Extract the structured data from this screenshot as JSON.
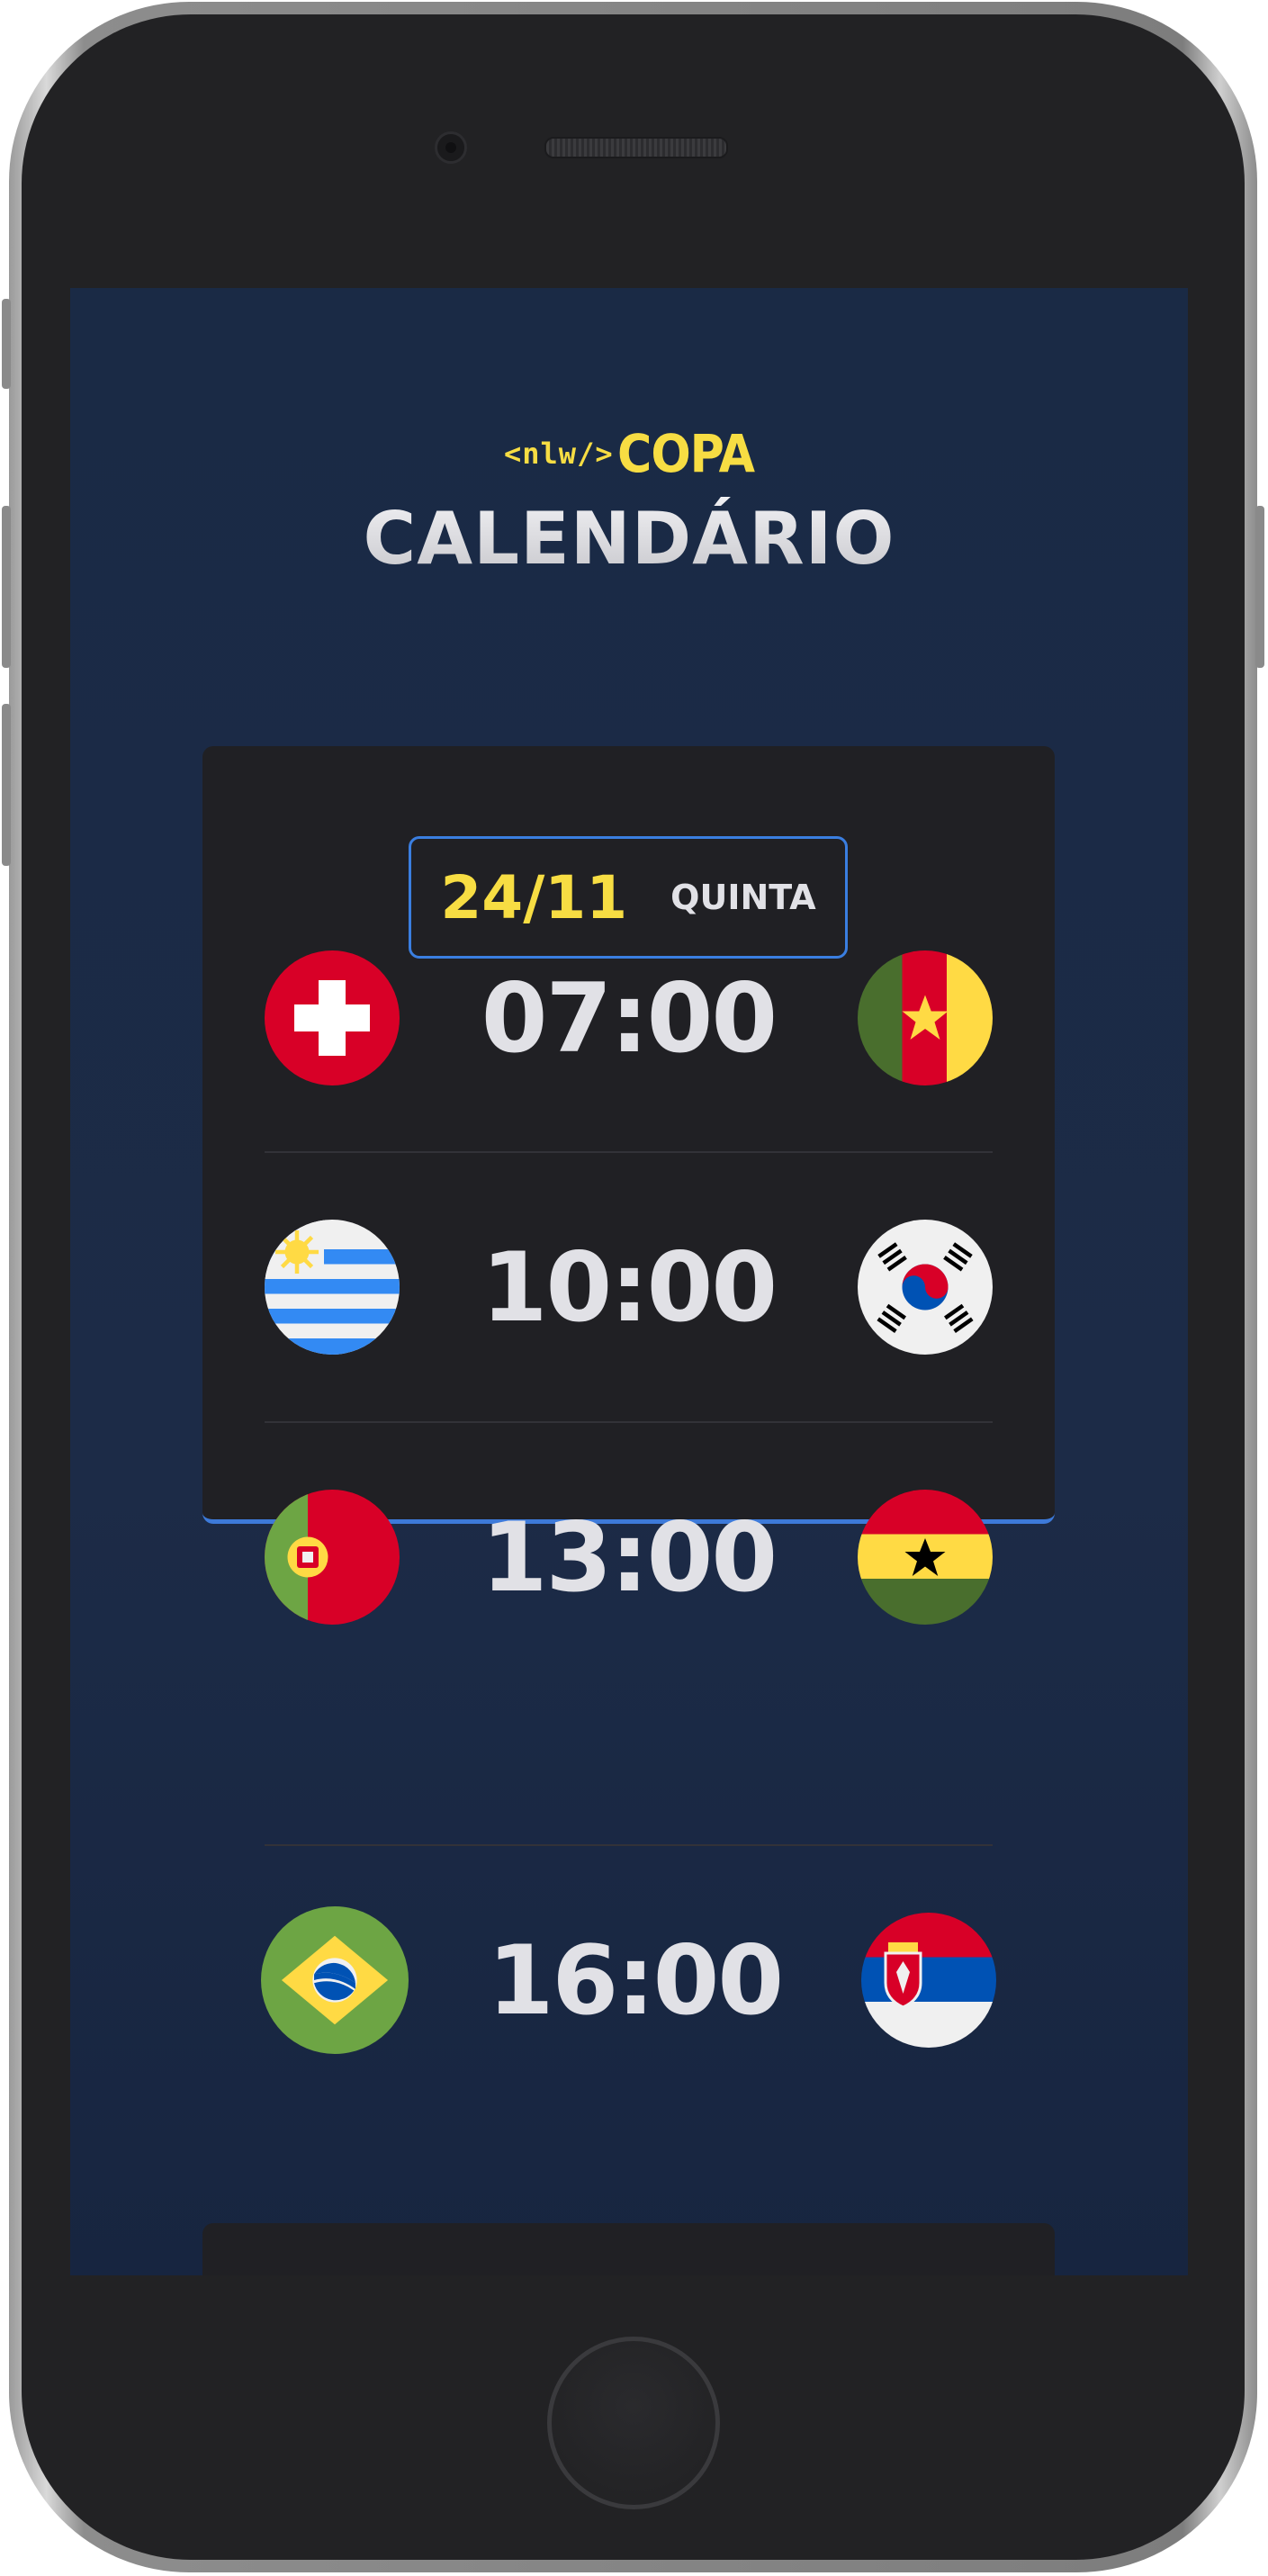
{
  "logo": {
    "tag": "<nlw/>",
    "name": "COPA"
  },
  "page": {
    "title": "CALENDÁRIO"
  },
  "day": {
    "date": "24/11",
    "weekday": "QUINTA",
    "matches": [
      {
        "time": "07:00",
        "home_flag": "switzerland-flag-icon",
        "away_flag": "cameroon-flag-icon"
      },
      {
        "time": "10:00",
        "home_flag": "uruguay-flag-icon",
        "away_flag": "south-korea-flag-icon"
      },
      {
        "time": "13:00",
        "home_flag": "portugal-flag-icon",
        "away_flag": "ghana-flag-icon"
      },
      {
        "time": "16:00",
        "home_flag": "brazil-flag-icon",
        "away_flag": "serbia-flag-icon"
      }
    ]
  },
  "colors": {
    "background": "#1c2b47",
    "card": "#202024",
    "accent_yellow": "#f7dd43",
    "accent_blue": "#3a7ee0",
    "text": "#e1e1e6"
  }
}
